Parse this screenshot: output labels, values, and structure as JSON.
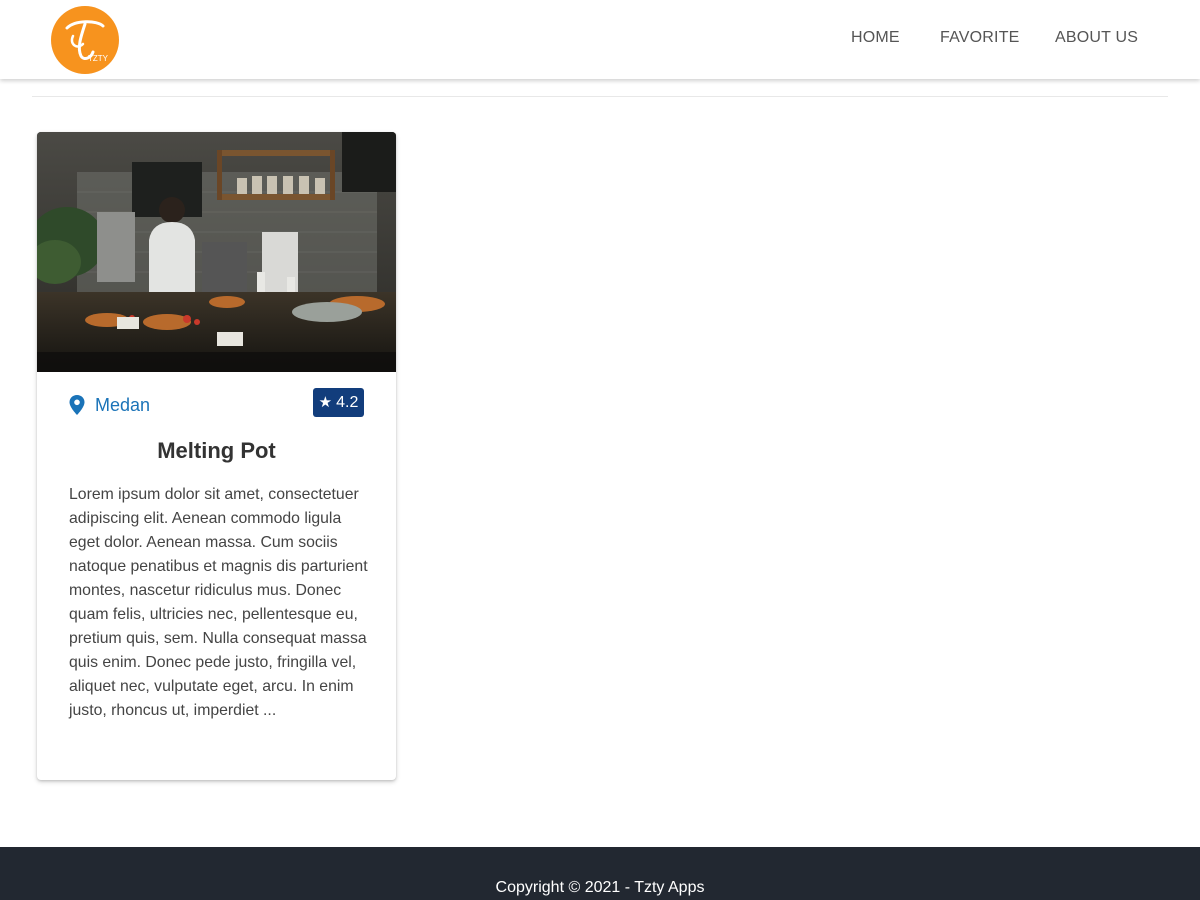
{
  "brand": {
    "logo_text": "TZTY",
    "logo_glyph": "T",
    "color": "#f7931e"
  },
  "nav": {
    "items": [
      {
        "label": "HOME"
      },
      {
        "label": "FAVORITE"
      },
      {
        "label": "ABOUT US"
      }
    ]
  },
  "restaurant": {
    "location": "Medan",
    "rating": "4.2",
    "name": "Melting Pot",
    "description": "Lorem ipsum dolor sit amet, consectetuer adipiscing elit. Aenean commodo ligula eget dolor. Aenean massa. Cum sociis natoque penatibus et magnis dis parturient montes, nascetur ridiculus mus. Donec quam felis, ultricies nec, pellentesque eu, pretium quis, sem. Nulla consequat massa quis enim. Donec pede justo, fringilla vel, aliquet nec, vulputate eget, arcu. In enim justo, rhoncus ut, imperdiet ...",
    "image": "restaurant-counter-photo",
    "location_icon": "map-pin-icon",
    "rating_icon": "star-icon"
  },
  "footer": {
    "text": "Copyright © 2021 - Tzty Apps"
  },
  "colors": {
    "link": "#1a73b8",
    "rating_badge": "#123d7c",
    "footer_bg": "#222831"
  }
}
